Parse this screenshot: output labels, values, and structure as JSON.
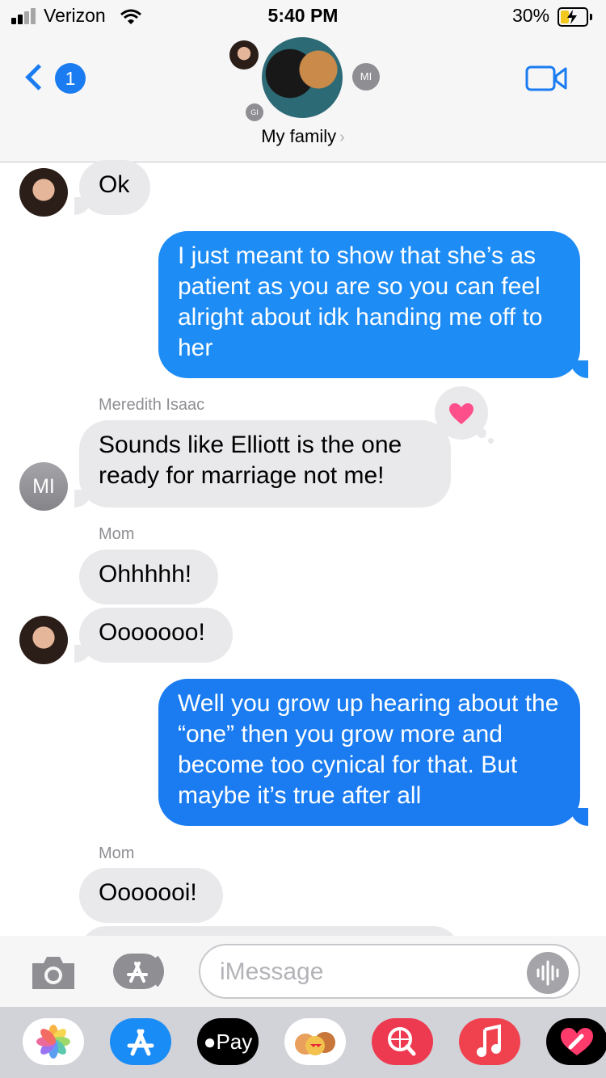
{
  "status_bar": {
    "carrier": "Verizon",
    "time": "5:40 PM",
    "battery": "30%"
  },
  "header": {
    "back_badge": "1",
    "group_name": "My family",
    "group_arrow": "›",
    "member_initials_1": "MI",
    "member_initials_2": "GI",
    "icons": [
      "back-chevron-icon",
      "video-camera-icon"
    ]
  },
  "messages": {
    "m1": {
      "text": "Ok",
      "direction": "incoming"
    },
    "m2": {
      "text": "I just meant to show that she’s as patient as you are so you can feel alright about idk handing me off to her",
      "direction": "outgoing"
    },
    "m3": {
      "sender": "Meredith Isaac",
      "text": "Sounds like Elliott is the one ready for marriage not me!",
      "direction": "incoming",
      "avatar_initials": "MI",
      "tapback": "heart"
    },
    "m4": {
      "sender": "Mom",
      "text": "Ohhhhh!",
      "direction": "incoming"
    },
    "m5": {
      "text": "Ooooooo!",
      "direction": "incoming"
    },
    "m6": {
      "text": "Well you grow up hearing about the “one” then you grow more and become too cynical for that. But maybe it’s true after all",
      "direction": "outgoing"
    },
    "m7": {
      "sender": "Mom",
      "text": "Ooooooi!",
      "direction": "incoming"
    }
  },
  "input": {
    "placeholder": "iMessage"
  },
  "app_drawer": {
    "apps": [
      "Photos",
      "App Store",
      "Pay",
      "Memoji",
      "Search",
      "Music",
      "Digital Touch"
    ],
    "pay_label": "Pay"
  },
  "colors": {
    "outgoing_bubble": "#1e8cf5",
    "incoming_bubble": "#e9e9eb",
    "tint": "#1a7cf0",
    "heart": "#ff4f8b"
  }
}
